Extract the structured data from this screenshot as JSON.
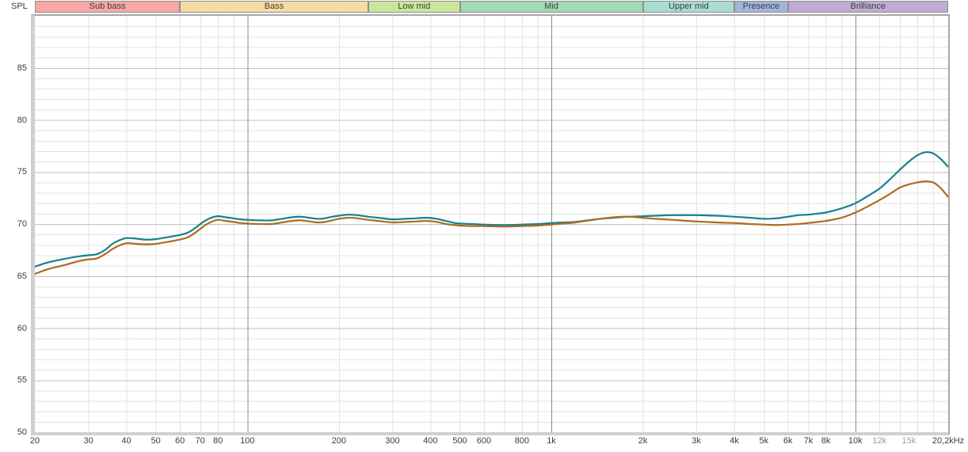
{
  "spl_label": "SPL",
  "bands": [
    {
      "label": "Sub bass",
      "from": 20,
      "to": 60,
      "color": "#f8a7a5"
    },
    {
      "label": "Bass",
      "from": 60,
      "to": 250,
      "color": "#f5dba1"
    },
    {
      "label": "Low mid",
      "from": 250,
      "to": 500,
      "color": "#cbe69b"
    },
    {
      "label": "Mid",
      "from": 500,
      "to": 2000,
      "color": "#9fdab4"
    },
    {
      "label": "Upper mid",
      "from": 2000,
      "to": 4000,
      "color": "#a9dcd2"
    },
    {
      "label": "Presence",
      "from": 4000,
      "to": 6000,
      "color": "#a2b3dc"
    },
    {
      "label": "Brilliance",
      "from": 6000,
      "to": 20200,
      "color": "#c0abd4"
    }
  ],
  "chart_data": {
    "type": "line",
    "title": "",
    "ylabel": "SPL",
    "x_scale": "log",
    "xlim": [
      20,
      20200
    ],
    "ylim": [
      50,
      90
    ],
    "grid": {
      "h_minor_step_db": 1,
      "h_major_step_db": 5,
      "v_minor_freqs": [
        30,
        40,
        50,
        60,
        70,
        80,
        90,
        200,
        300,
        400,
        500,
        600,
        700,
        800,
        900,
        2000,
        3000,
        4000,
        5000,
        6000,
        7000,
        8000,
        9000,
        12000,
        14000,
        16000,
        18000
      ],
      "v_major_freqs": [
        100,
        1000,
        10000
      ]
    },
    "x_ticks": [
      {
        "label": "20",
        "f": 20
      },
      {
        "label": "30",
        "f": 30
      },
      {
        "label": "40",
        "f": 40
      },
      {
        "label": "50",
        "f": 50
      },
      {
        "label": "60",
        "f": 60
      },
      {
        "label": "70",
        "f": 70
      },
      {
        "label": "80",
        "f": 80
      },
      {
        "label": "100",
        "f": 100
      },
      {
        "label": "200",
        "f": 200
      },
      {
        "label": "300",
        "f": 300
      },
      {
        "label": "400",
        "f": 400
      },
      {
        "label": "500",
        "f": 500
      },
      {
        "label": "600",
        "f": 600
      },
      {
        "label": "800",
        "f": 800
      },
      {
        "label": "1k",
        "f": 1000
      },
      {
        "label": "2k",
        "f": 2000
      },
      {
        "label": "3k",
        "f": 3000
      },
      {
        "label": "4k",
        "f": 4000
      },
      {
        "label": "5k",
        "f": 5000
      },
      {
        "label": "6k",
        "f": 6000
      },
      {
        "label": "7k",
        "f": 7000
      },
      {
        "label": "8k",
        "f": 8000
      },
      {
        "label": "10k",
        "f": 10000
      },
      {
        "label": "12k",
        "f": 12000,
        "muted": true
      },
      {
        "label": "15k",
        "f": 15000,
        "muted": true
      },
      {
        "label": "20,2kHz",
        "f": 20200
      }
    ],
    "y_ticks": [
      {
        "label": "85",
        "v": 85
      },
      {
        "label": "80",
        "v": 80
      },
      {
        "label": "75",
        "v": 75
      },
      {
        "label": "70",
        "v": 70
      },
      {
        "label": "65",
        "v": 65
      },
      {
        "label": "60",
        "v": 60
      },
      {
        "label": "55",
        "v": 55
      },
      {
        "label": "50",
        "v": 50
      }
    ],
    "series": [
      {
        "name": "teal-curve",
        "color": "#17818f",
        "points": [
          [
            20,
            65.9
          ],
          [
            22,
            66.3
          ],
          [
            25,
            66.65
          ],
          [
            28,
            66.9
          ],
          [
            30,
            67.0
          ],
          [
            32,
            67.1
          ],
          [
            34,
            67.5
          ],
          [
            36,
            68.1
          ],
          [
            38,
            68.45
          ],
          [
            40,
            68.65
          ],
          [
            43,
            68.6
          ],
          [
            46,
            68.5
          ],
          [
            50,
            68.55
          ],
          [
            55,
            68.75
          ],
          [
            60,
            68.95
          ],
          [
            64,
            69.2
          ],
          [
            68,
            69.7
          ],
          [
            72,
            70.25
          ],
          [
            76,
            70.6
          ],
          [
            80,
            70.75
          ],
          [
            85,
            70.65
          ],
          [
            90,
            70.55
          ],
          [
            95,
            70.45
          ],
          [
            100,
            70.4
          ],
          [
            110,
            70.35
          ],
          [
            120,
            70.35
          ],
          [
            130,
            70.5
          ],
          [
            140,
            70.65
          ],
          [
            150,
            70.7
          ],
          [
            160,
            70.6
          ],
          [
            170,
            70.5
          ],
          [
            180,
            70.55
          ],
          [
            190,
            70.7
          ],
          [
            200,
            70.8
          ],
          [
            215,
            70.9
          ],
          [
            230,
            70.85
          ],
          [
            250,
            70.7
          ],
          [
            270,
            70.6
          ],
          [
            300,
            70.45
          ],
          [
            330,
            70.5
          ],
          [
            360,
            70.55
          ],
          [
            390,
            70.6
          ],
          [
            420,
            70.5
          ],
          [
            450,
            70.3
          ],
          [
            480,
            70.1
          ],
          [
            500,
            70.05
          ],
          [
            550,
            70.0
          ],
          [
            600,
            69.95
          ],
          [
            700,
            69.9
          ],
          [
            800,
            69.95
          ],
          [
            900,
            70.0
          ],
          [
            1000,
            70.1
          ],
          [
            1100,
            70.15
          ],
          [
            1200,
            70.2
          ],
          [
            1400,
            70.45
          ],
          [
            1600,
            70.6
          ],
          [
            1800,
            70.7
          ],
          [
            2000,
            70.75
          ],
          [
            2200,
            70.8
          ],
          [
            2500,
            70.85
          ],
          [
            3000,
            70.85
          ],
          [
            3500,
            70.8
          ],
          [
            4000,
            70.7
          ],
          [
            4500,
            70.6
          ],
          [
            5000,
            70.5
          ],
          [
            5500,
            70.55
          ],
          [
            6000,
            70.7
          ],
          [
            6500,
            70.85
          ],
          [
            7000,
            70.9
          ],
          [
            7500,
            71.0
          ],
          [
            8000,
            71.1
          ],
          [
            9000,
            71.5
          ],
          [
            10000,
            72.0
          ],
          [
            11000,
            72.7
          ],
          [
            12000,
            73.4
          ],
          [
            13000,
            74.3
          ],
          [
            14000,
            75.2
          ],
          [
            15000,
            76.0
          ],
          [
            16000,
            76.6
          ],
          [
            17000,
            76.9
          ],
          [
            18000,
            76.8
          ],
          [
            19000,
            76.3
          ],
          [
            20200,
            75.5
          ]
        ]
      },
      {
        "name": "orange-curve",
        "color": "#ae6b20",
        "points": [
          [
            20,
            65.2
          ],
          [
            22,
            65.65
          ],
          [
            25,
            66.05
          ],
          [
            28,
            66.45
          ],
          [
            30,
            66.6
          ],
          [
            32,
            66.7
          ],
          [
            34,
            67.1
          ],
          [
            36,
            67.6
          ],
          [
            38,
            67.95
          ],
          [
            40,
            68.15
          ],
          [
            43,
            68.1
          ],
          [
            46,
            68.05
          ],
          [
            50,
            68.1
          ],
          [
            55,
            68.3
          ],
          [
            60,
            68.5
          ],
          [
            64,
            68.75
          ],
          [
            68,
            69.25
          ],
          [
            72,
            69.8
          ],
          [
            76,
            70.2
          ],
          [
            80,
            70.4
          ],
          [
            85,
            70.3
          ],
          [
            90,
            70.2
          ],
          [
            95,
            70.1
          ],
          [
            100,
            70.05
          ],
          [
            110,
            70.0
          ],
          [
            120,
            70.0
          ],
          [
            130,
            70.15
          ],
          [
            140,
            70.3
          ],
          [
            150,
            70.35
          ],
          [
            160,
            70.25
          ],
          [
            170,
            70.15
          ],
          [
            180,
            70.2
          ],
          [
            190,
            70.35
          ],
          [
            200,
            70.5
          ],
          [
            215,
            70.6
          ],
          [
            230,
            70.55
          ],
          [
            250,
            70.4
          ],
          [
            270,
            70.3
          ],
          [
            300,
            70.15
          ],
          [
            330,
            70.2
          ],
          [
            360,
            70.25
          ],
          [
            390,
            70.3
          ],
          [
            420,
            70.2
          ],
          [
            450,
            70.0
          ],
          [
            480,
            69.9
          ],
          [
            500,
            69.85
          ],
          [
            550,
            69.8
          ],
          [
            600,
            69.8
          ],
          [
            700,
            69.75
          ],
          [
            800,
            69.8
          ],
          [
            900,
            69.85
          ],
          [
            1000,
            69.95
          ],
          [
            1100,
            70.05
          ],
          [
            1200,
            70.15
          ],
          [
            1400,
            70.45
          ],
          [
            1600,
            70.65
          ],
          [
            1800,
            70.7
          ],
          [
            2000,
            70.6
          ],
          [
            2200,
            70.5
          ],
          [
            2500,
            70.4
          ],
          [
            3000,
            70.25
          ],
          [
            3500,
            70.15
          ],
          [
            4000,
            70.1
          ],
          [
            4500,
            70.0
          ],
          [
            5000,
            69.95
          ],
          [
            5500,
            69.9
          ],
          [
            6000,
            69.95
          ],
          [
            6500,
            70.0
          ],
          [
            7000,
            70.1
          ],
          [
            7500,
            70.2
          ],
          [
            8000,
            70.3
          ],
          [
            9000,
            70.6
          ],
          [
            10000,
            71.1
          ],
          [
            11000,
            71.7
          ],
          [
            12000,
            72.3
          ],
          [
            13000,
            72.9
          ],
          [
            14000,
            73.5
          ],
          [
            15000,
            73.8
          ],
          [
            16000,
            74.0
          ],
          [
            17000,
            74.1
          ],
          [
            18000,
            74.0
          ],
          [
            19000,
            73.5
          ],
          [
            20200,
            72.6
          ]
        ]
      }
    ],
    "grid_colors": {
      "minor": "#e3e3e3",
      "h_major": "#bfbfbf",
      "v_major": "#8c8c8c"
    }
  }
}
